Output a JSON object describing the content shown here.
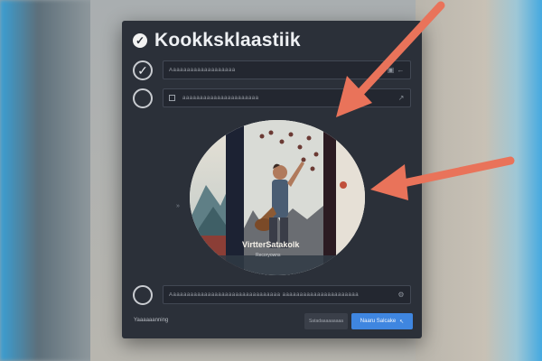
{
  "window": {
    "title": "Kookksklaastiik"
  },
  "rows": [
    {
      "field_text": "Aaaaaaaaaaaaaaaaaaa",
      "end_icon": "▣ ←"
    },
    {
      "field_text": "aaaaaaaaaaaaaaaaaaaaaa",
      "end_icon": "↗"
    }
  ],
  "cover": {
    "title": "VirtterSatakolk",
    "subtitle": "Recoryowns"
  },
  "side_icon": "»",
  "bottom_field": {
    "text": "Aaaaaaaaaaaaaaaaaaaaaaaaaaaaaaaa aaaaaaaaaaaaaaaaaaaaaa"
  },
  "footer": {
    "left_text": "Yaaaaaanning",
    "secondary_button": "Satadaaaaaaaaa",
    "primary_button": "Naaru Salcake"
  },
  "colors": {
    "accent": "#3f86e0",
    "annotation_arrow": "#e9735a",
    "dialog_bg": "#2b3039"
  }
}
